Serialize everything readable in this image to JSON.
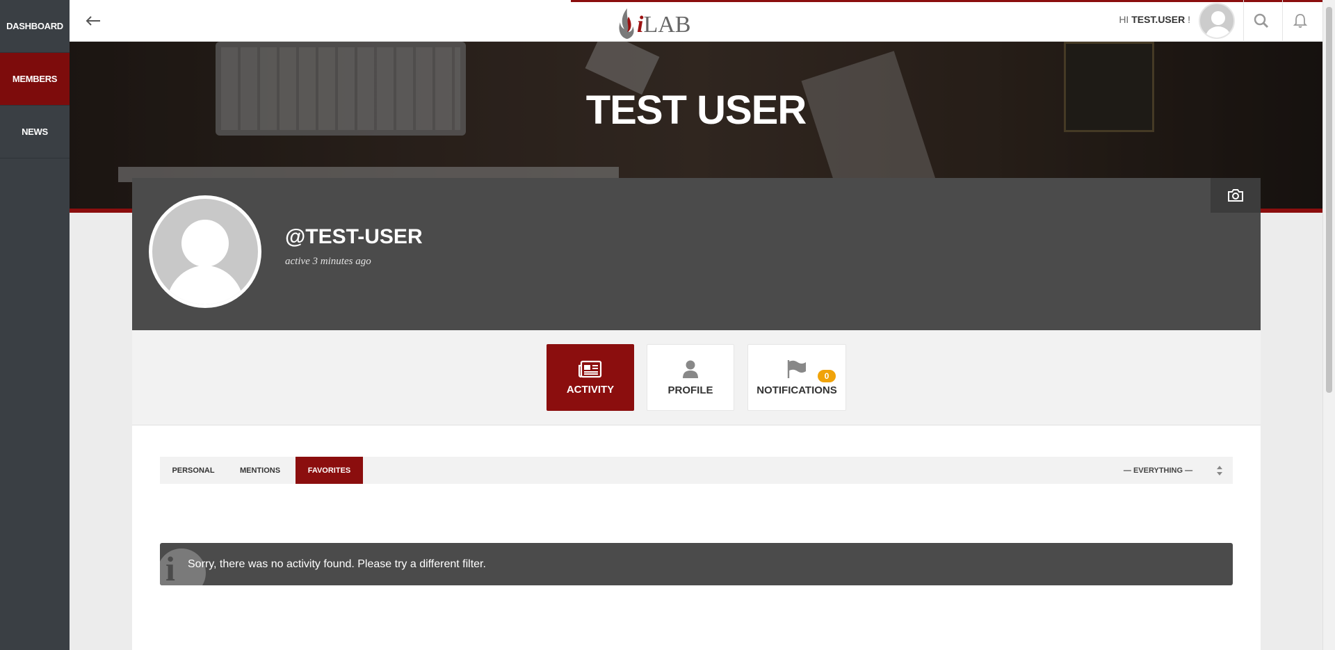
{
  "sidebar": {
    "items": [
      {
        "label": "DASHBOARD"
      },
      {
        "label": "MEMBERS",
        "active": true
      },
      {
        "label": "NEWS"
      }
    ]
  },
  "header": {
    "greeting_prefix": "HI",
    "username": "TEST.USER",
    "greeting_suffix": "!",
    "logo_text": "LAB",
    "logo_i": "i"
  },
  "hero": {
    "title": "TEST USER"
  },
  "profile": {
    "handle": "@TEST-USER",
    "last_active": "active 3 minutes ago"
  },
  "tabs": [
    {
      "label": "ACTIVITY",
      "icon": "newspaper-icon",
      "active": true
    },
    {
      "label": "PROFILE",
      "icon": "person-icon"
    },
    {
      "label": "NOTIFICATIONS",
      "icon": "flag-icon",
      "badge": "0"
    }
  ],
  "subnav": {
    "tabs": [
      {
        "label": "PERSONAL"
      },
      {
        "label": "MENTIONS"
      },
      {
        "label": "FAVORITES",
        "active": true
      }
    ],
    "filter_value": "— EVERYTHING —"
  },
  "notice": {
    "message": "Sorry, there was no activity found. Please try a different filter."
  },
  "colors": {
    "accent": "#8b0e0e",
    "sidebar": "#3a3f44",
    "card_header": "#4b4b4b",
    "badge": "#f0a30a"
  }
}
